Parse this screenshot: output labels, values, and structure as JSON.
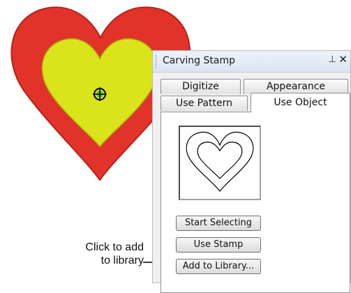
{
  "panel": {
    "title": "Carving Stamp",
    "pin_glyph": "⊥",
    "close_glyph": "✕",
    "tabs": [
      {
        "label": "Digitize"
      },
      {
        "label": "Appearance"
      },
      {
        "label": "Use Pattern"
      },
      {
        "label": "Use Object"
      }
    ],
    "buttons": {
      "start_selecting": "Start Selecting",
      "use_stamp": "Use Stamp",
      "add_to_library": "Add to Library..."
    }
  },
  "callout": {
    "line1": "Click to add",
    "line2": "to library"
  },
  "colors": {
    "heart_outer": "#e2332b",
    "heart_inner": "#dbe31a",
    "accent": "#2a8a3a"
  }
}
